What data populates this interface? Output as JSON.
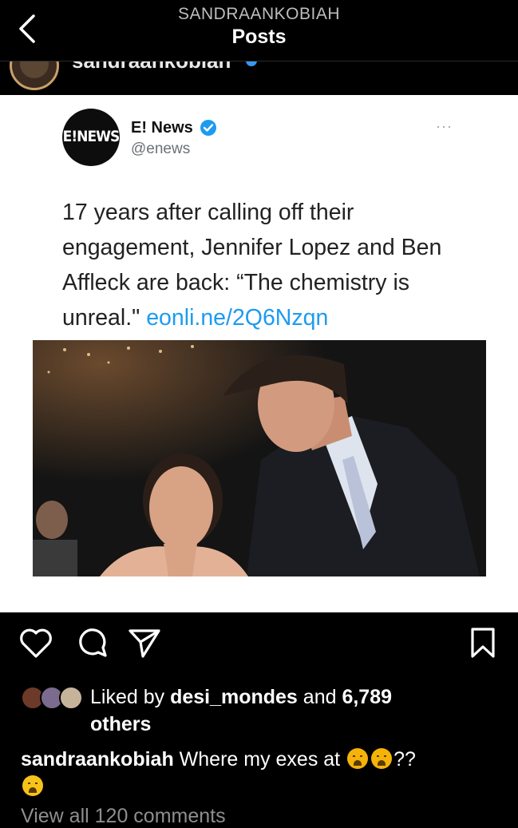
{
  "header": {
    "username": "SANDRAANKOBIAH",
    "title": "Posts",
    "peek_username": "sandraankobiah"
  },
  "tweet": {
    "avatar_text": "E!NEWS",
    "name": "E! News",
    "handle": "@enews",
    "more": "···",
    "text": "17 years after calling off their engagement, Jennifer Lopez and Ben Affleck are back: “The chemistry is unreal.\"",
    "link": "eonli.ne/2Q6Nzqn"
  },
  "actions": {
    "like_icon": "heart-icon",
    "comment_icon": "comment-icon",
    "share_icon": "send-icon",
    "save_icon": "bookmark-icon"
  },
  "likes": {
    "prefix": "Liked by ",
    "user": "desi_mondes",
    "middle": " and ",
    "count": "6,789",
    "suffix": "others"
  },
  "caption": {
    "username": "sandraankobiah",
    "text": " Where my exes at ",
    "punct": "??"
  },
  "comments": {
    "view_all": "View all 120 comments"
  },
  "colors": {
    "background": "#000000",
    "link": "#1d9bf0",
    "verified": "#1d9bf0",
    "emoji": "#f5b30a"
  }
}
